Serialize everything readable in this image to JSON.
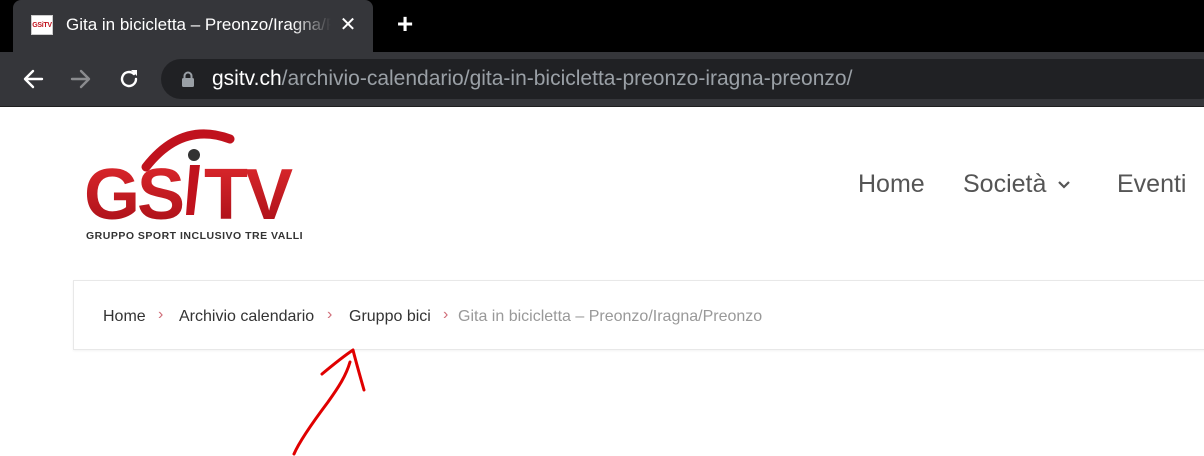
{
  "tab": {
    "favicon_text": "GSiTV",
    "title": "Gita in bicicletta – Preonzo/Iragna/Preonzo",
    "close_symbol": "✕",
    "new_tab_symbol": "+"
  },
  "toolbar": {
    "back_icon": "arrow-left-icon",
    "forward_icon": "arrow-right-icon",
    "reload_icon": "reload-icon",
    "url_host": "gsitv.ch",
    "url_path": "/archivio-calendario/gita-in-bicicletta-preonzo-iragna-preonzo/"
  },
  "site": {
    "logo_text": "GSiTV",
    "logo_tagline": "GRUPPO SPORT INCLUSIVO TRE VALLI",
    "brand_color": "#c0121d",
    "nav": [
      "Home",
      "Società",
      "Eventi"
    ],
    "nav_dropdown_symbol": "›"
  },
  "breadcrumb": {
    "items": [
      "Home",
      "Archivio calendario",
      "Gruppo bici"
    ],
    "current": "Gita in bicicletta – Preonzo/Iragna/Preonzo",
    "separator": "›",
    "separator_color": "#d06d78"
  },
  "annotation": {
    "type": "hand-drawn arrow",
    "color": "#e00000",
    "points_to": "Gruppo bici"
  }
}
